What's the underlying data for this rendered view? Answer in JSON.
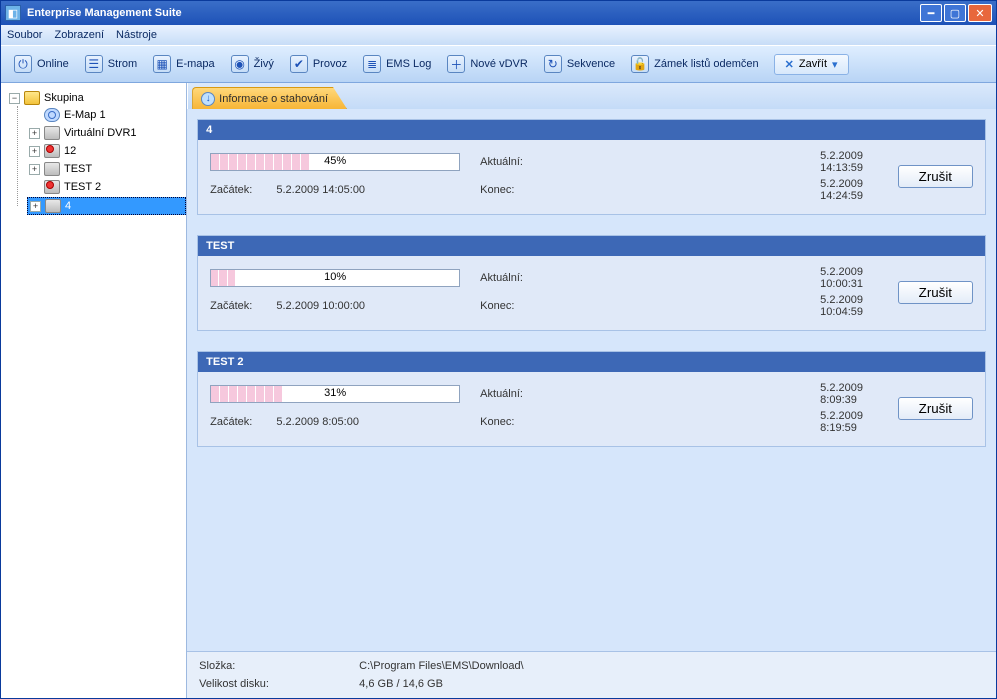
{
  "window": {
    "title": "Enterprise Management Suite"
  },
  "menu": {
    "file": "Soubor",
    "view": "Zobrazení",
    "tools": "Nástroje"
  },
  "toolbar": {
    "online": "Online",
    "tree": "Strom",
    "emap": "E-mapa",
    "live": "Živý",
    "traffic": "Provoz",
    "emslog": "EMS Log",
    "newvdvr": "Nové vDVR",
    "sequence": "Sekvence",
    "lock": "Zámek listů odemčen",
    "close": "Zavřít"
  },
  "tree": {
    "root_label": "Skupina",
    "items": {
      "emap1": "E-Map 1",
      "vdvr1": "Virtuální DVR1",
      "n12": "12",
      "test": "TEST",
      "test2": "TEST 2",
      "four": "4"
    }
  },
  "tab": {
    "title": "Informace o stahování"
  },
  "labels": {
    "start": "Začátek:",
    "current": "Aktuální:",
    "end": "Konec:",
    "cancel": "Zrušit"
  },
  "downloads": [
    {
      "title": "4",
      "percent": 45,
      "percent_label": "45%",
      "start": "5.2.2009 14:05:00",
      "current": "5.2.2009 14:13:59",
      "end": "5.2.2009 14:24:59"
    },
    {
      "title": "TEST",
      "percent": 10,
      "percent_label": "10%",
      "start": "5.2.2009 10:00:00",
      "current": "5.2.2009 10:00:31",
      "end": "5.2.2009 10:04:59"
    },
    {
      "title": "TEST 2",
      "percent": 31,
      "percent_label": "31%",
      "start": "5.2.2009 8:05:00",
      "current": "5.2.2009 8:09:39",
      "end": "5.2.2009 8:19:59"
    }
  ],
  "footer": {
    "folder_label": "Složka:",
    "folder_value": "C:\\Program Files\\EMS\\Download\\",
    "disk_label": "Velikost disku:",
    "disk_value": "4,6 GB / 14,6 GB"
  }
}
